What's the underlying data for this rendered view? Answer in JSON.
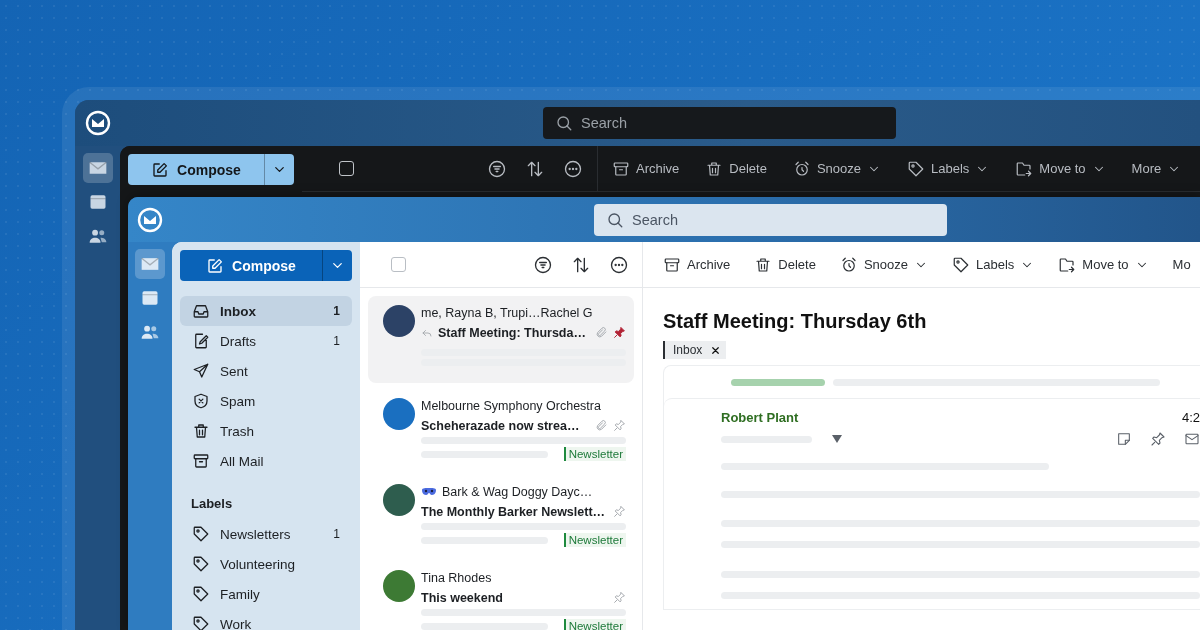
{
  "back_window": {
    "search": {
      "placeholder": "Search"
    },
    "rail": [
      {
        "kind": "mail",
        "selected": true
      },
      {
        "kind": "calendar",
        "selected": false
      },
      {
        "kind": "contacts",
        "selected": false
      }
    ],
    "compose": {
      "label": "Compose"
    },
    "select_all": {
      "checked": false
    },
    "list_tools": [
      {
        "kind": "filter"
      },
      {
        "kind": "sort"
      },
      {
        "kind": "more"
      }
    ],
    "actions": [
      {
        "kind": "archive",
        "label": "Archive",
        "menu": false
      },
      {
        "kind": "delete",
        "label": "Delete",
        "menu": false
      },
      {
        "kind": "snooze",
        "label": "Snooze",
        "menu": true
      },
      {
        "kind": "labels",
        "label": "Labels",
        "menu": true
      },
      {
        "kind": "move",
        "label": "Move to",
        "menu": true
      },
      {
        "kind": "more",
        "label": "More",
        "menu": true
      }
    ]
  },
  "front_window": {
    "search": {
      "placeholder": "Search"
    },
    "rail": [
      {
        "kind": "mail",
        "selected": true
      },
      {
        "kind": "calendar",
        "selected": false
      },
      {
        "kind": "contacts",
        "selected": false
      }
    ],
    "compose": {
      "label": "Compose"
    },
    "select_all": {
      "checked": false
    },
    "list_tools": [
      {
        "kind": "filter"
      },
      {
        "kind": "sort"
      },
      {
        "kind": "more"
      }
    ],
    "actions": [
      {
        "kind": "archive",
        "label": "Archive",
        "menu": false
      },
      {
        "kind": "delete",
        "label": "Delete",
        "menu": false
      },
      {
        "kind": "snooze",
        "label": "Snooze",
        "menu": true
      },
      {
        "kind": "labels",
        "label": "Labels",
        "menu": true
      },
      {
        "kind": "move",
        "label": "Move to",
        "menu": true
      },
      {
        "kind": "more",
        "label": "Mo",
        "menu": false
      }
    ],
    "folders": [
      {
        "kind": "inbox",
        "label": "Inbox",
        "count": "1",
        "selected": true
      },
      {
        "kind": "drafts",
        "label": "Drafts",
        "count": "1",
        "selected": false
      },
      {
        "kind": "sent",
        "label": "Sent",
        "selected": false
      },
      {
        "kind": "spam",
        "label": "Spam",
        "selected": false
      },
      {
        "kind": "trash",
        "label": "Trash",
        "selected": false
      },
      {
        "kind": "all",
        "label": "All Mail",
        "selected": false
      }
    ],
    "labels_heading": "Labels",
    "labels": [
      {
        "label": "Newsletters",
        "count": "1",
        "selected": false
      },
      {
        "label": "Volunteering",
        "selected": false
      },
      {
        "label": "Family",
        "selected": false
      },
      {
        "label": "Work",
        "selected": false
      }
    ],
    "messages": [
      {
        "sender": "me, Rayna B, Trupi…Rachel G",
        "subject": "Staff Meeting: Thursda…",
        "color": "#2c4266",
        "badge": false,
        "replied": true,
        "attachment": true,
        "pinned": true,
        "selected": true
      },
      {
        "sender": "Melbourne Symphony Orchestra",
        "subject": "Scheherazade now strea…",
        "color": "#1a6fc0",
        "badge": false,
        "replied": false,
        "attachment": true,
        "pinned": false,
        "selected": false,
        "tag": "Newsletter"
      },
      {
        "sender": "Bark & Wag Doggy Dayc…",
        "subject": "The Monthly Barker Newslett…",
        "color": "#2e5d4e",
        "badge": true,
        "replied": false,
        "attachment": false,
        "pinned": false,
        "selected": false,
        "tag": "Newsletter"
      },
      {
        "sender": "Tina Rhodes",
        "subject": "This weekend",
        "color": "#3d7a34",
        "badge": false,
        "replied": false,
        "attachment": false,
        "pinned": false,
        "selected": false,
        "tag": "Newsletter"
      }
    ],
    "reader": {
      "title": "Staff Meeting: Thursday 6th",
      "tags": [
        {
          "label": "Inbox"
        }
      ],
      "sender": "Robert Plant",
      "time": "4:2"
    }
  }
}
